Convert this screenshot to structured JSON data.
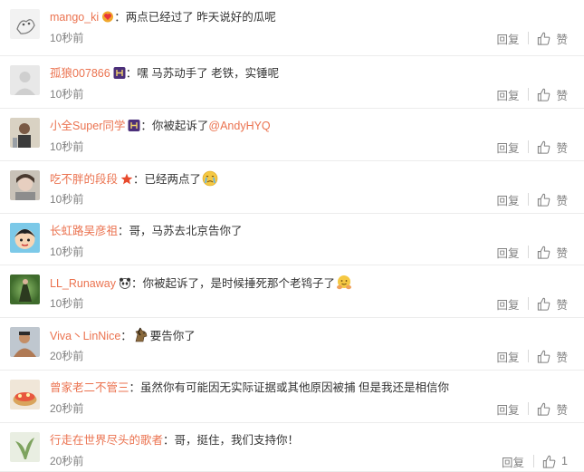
{
  "comments": [
    {
      "user": "mango_ki",
      "badge": "heart-badge",
      "sep": "：",
      "text": "两点已经过了 昨天说好的瓜呢",
      "time": "10秒前",
      "reply": "回复",
      "like": "赞",
      "avatar": "sketch-avatar"
    },
    {
      "user": "孤狼007866",
      "badge": "night-badge",
      "sep": "：",
      "text": "嘿  马苏动手了   老铁，实锤呢",
      "time": "10秒前",
      "reply": "回复",
      "like": "赞",
      "avatar": "default-avatar"
    },
    {
      "user": "小全Super同学",
      "badge": "night-badge",
      "sep": "：",
      "text": "你被起诉了",
      "mention": "@AndyHYQ",
      "time": "10秒前",
      "reply": "回复",
      "like": "赞",
      "avatar": "person-avatar"
    },
    {
      "user": "吃不胖的段段",
      "badge": "star-badge",
      "sep": "：",
      "text": "已经两点了",
      "emoji_after": "crying-emoji",
      "time": "10秒前",
      "reply": "回复",
      "like": "赞",
      "avatar": "photo-avatar"
    },
    {
      "user": "长虹路吴彦祖",
      "sep": "：",
      "text": "哥，马苏去北京告你了",
      "time": "10秒前",
      "reply": "回复",
      "like": "赞",
      "avatar": "cartoon-avatar"
    },
    {
      "user": "LL_Runaway",
      "badge": "panda-badge",
      "sep": "：",
      "text": "你被起诉了，是时候捶死那个老鸨子了",
      "emoji_after": "hug-emoji",
      "time": "10秒前",
      "reply": "回复",
      "like": "赞",
      "avatar": "green-avatar"
    },
    {
      "user": "Viva丶LinNice",
      "sep": "：",
      "emoji_before": "horse-emoji",
      "text": "要告你了",
      "time": "20秒前",
      "reply": "回复",
      "like": "赞",
      "avatar": "man-avatar"
    },
    {
      "user": "曾家老二不管三",
      "sep": "：",
      "text": "虽然你有可能因无实际证据或其他原因被捕 但是我还是相信你",
      "time": "20秒前",
      "reply": "回复",
      "like": "赞",
      "avatar": "food-avatar"
    },
    {
      "user": "行走在世界尽头的歌者",
      "sep": "：",
      "text": "哥，挺住，我们支持你！",
      "time": "20秒前",
      "reply": "回复",
      "like": "1",
      "avatar": "plant-avatar"
    }
  ],
  "colors": {
    "username": "#eb7350",
    "meta": "#808080",
    "text": "#333333",
    "divider": "#ececec"
  }
}
